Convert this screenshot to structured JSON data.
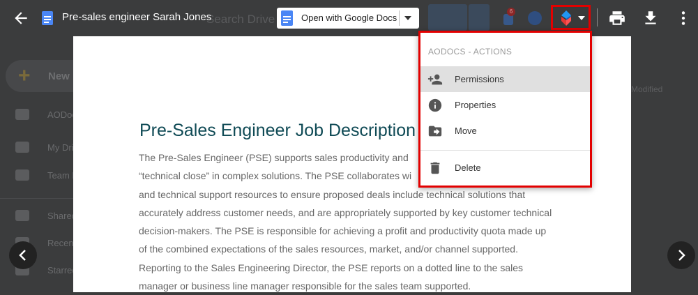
{
  "background": {
    "search_placeholder": "Search Drive",
    "new_label": "New",
    "nav": [
      {
        "label": "AODocs",
        "icon": "search-icon"
      },
      {
        "label": "My Drive",
        "icon": "drive-icon"
      },
      {
        "label": "Team Drives",
        "icon": "team-drive-icon"
      },
      {
        "label": "Shared with me",
        "icon": "people-icon"
      },
      {
        "label": "Recent",
        "icon": "clock-icon"
      },
      {
        "label": "Starred",
        "icon": "star-icon"
      }
    ],
    "right_header": "Modified"
  },
  "topbar": {
    "back_icon": "arrow-left-icon",
    "title": "Pre-sales engineer Sarah Jones",
    "open_with_label": "Open with Google Docs",
    "notification_count": "6",
    "print_icon": "print-icon",
    "download_icon": "download-icon",
    "more_icon": "more-vert-icon"
  },
  "document": {
    "heading": "Pre-Sales Engineer Job Description",
    "lines": [
      "The Pre-Sales Engineer (PSE) supports sales productivity and",
      "“technical close” in complex solutions. The PSE collaborates wi",
      "and technical support resources to ensure proposed deals include technical solutions that",
      "accurately address customer needs, and are appropriately supported by key customer technical",
      "decision-makers. The PSE is responsible for achieving a profit and productivity quota made up",
      "of the combined expectations of the sales resources, market, and/or channel supported.",
      "Reporting to the Sales Engineering Director, the PSE reports on a dotted line to the sales",
      "manager or business line manager responsible for the sales team supported."
    ]
  },
  "menu": {
    "header": "AODOCS - ACTIONS",
    "items": [
      {
        "label": "Permissions",
        "icon": "person-add-icon",
        "active": true
      },
      {
        "label": "Properties",
        "icon": "info-icon",
        "active": false
      },
      {
        "label": "Move",
        "icon": "folder-move-icon",
        "active": false
      },
      {
        "label": "Delete",
        "icon": "trash-icon",
        "active": false
      }
    ]
  },
  "colors": {
    "highlight": "#e30000",
    "doc_heading": "#0f4a55",
    "google_blue": "#4a86f5"
  }
}
